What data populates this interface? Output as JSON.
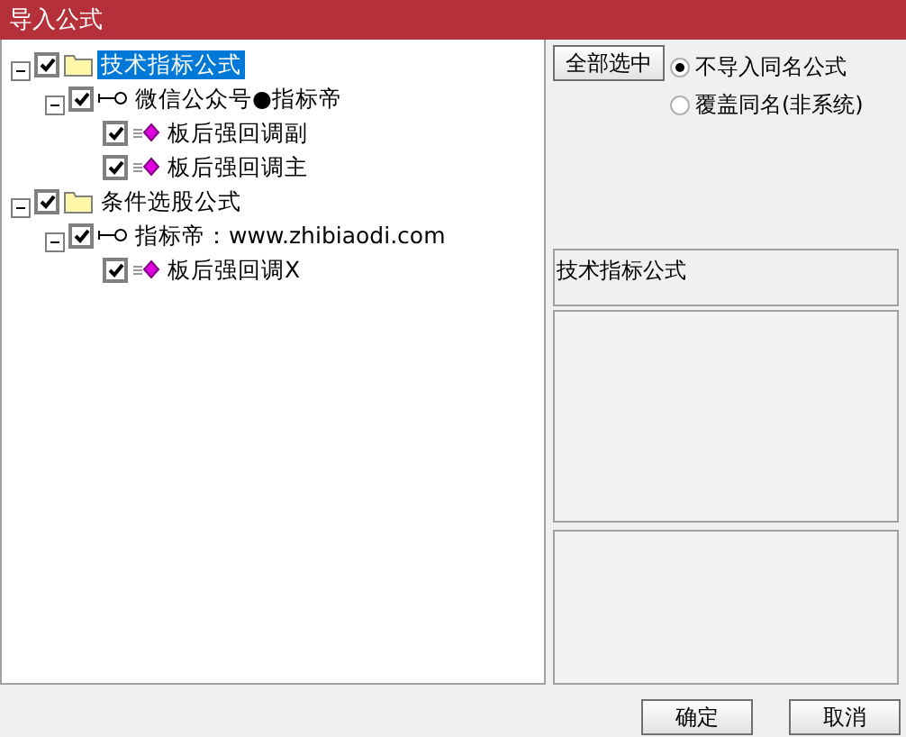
{
  "window": {
    "title": "导入公式"
  },
  "tree": [
    {
      "kind": "folder",
      "label": "技术指标公式",
      "checked": true,
      "expanded": true,
      "selected": true,
      "children": [
        {
          "kind": "group",
          "label": "微信公众号●指标帝",
          "checked": true,
          "expanded": true,
          "selected": false,
          "children": [
            {
              "kind": "formula",
              "label": "板后强回调副",
              "checked": true,
              "selected": false
            },
            {
              "kind": "formula",
              "label": "板后强回调主",
              "checked": true,
              "selected": false
            }
          ]
        }
      ]
    },
    {
      "kind": "folder",
      "label": "条件选股公式",
      "checked": true,
      "expanded": true,
      "selected": false,
      "children": [
        {
          "kind": "group",
          "label": "指标帝：www.zhibiaodi.com",
          "checked": true,
          "expanded": true,
          "selected": false,
          "children": [
            {
              "kind": "formula",
              "label": "板后强回调X",
              "checked": true,
              "selected": false
            }
          ]
        }
      ]
    }
  ],
  "select_all_button": "全部选中",
  "options": [
    {
      "label": "不导入同名公式",
      "selected": true
    },
    {
      "label": "覆盖同名(非系统)",
      "selected": false
    }
  ],
  "info_box": {
    "text": "技术指标公式"
  },
  "buttons": [
    "确定",
    "取消"
  ]
}
